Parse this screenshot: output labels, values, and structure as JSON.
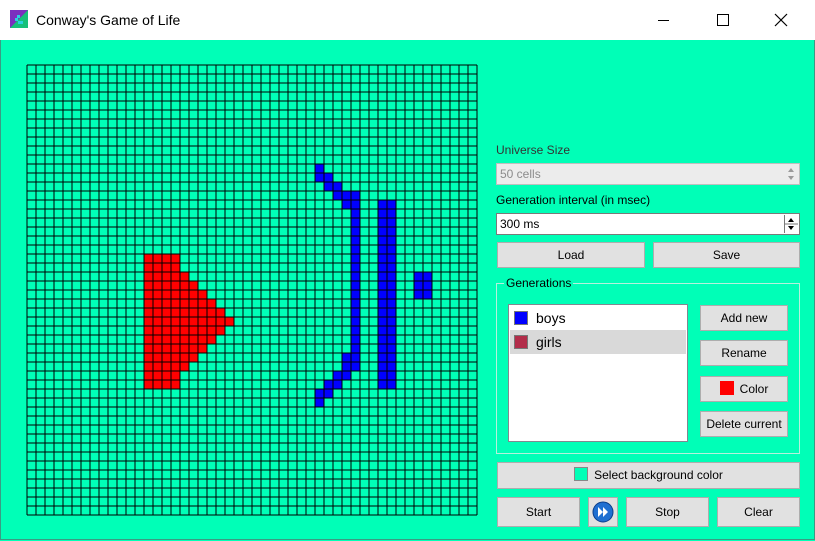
{
  "window": {
    "title": "Conway's Game of Life",
    "icon": "game-of-life-app-icon",
    "controls": [
      "minimize-icon",
      "maximize-icon",
      "close-icon"
    ]
  },
  "colors": {
    "background": "#00ffb7",
    "grid_line": "#000000",
    "boys": "#0000ff",
    "girls": "#ff0000",
    "girls_swatch": "#b22d4a"
  },
  "universe": {
    "size_label": "Universe Size",
    "size_value": "50 cells",
    "interval_label": "Generation interval (in msec)",
    "interval_value": "300 ms"
  },
  "buttons": {
    "load": "Load",
    "save": "Save",
    "add_new": "Add new",
    "rename": "Rename",
    "color": "Color",
    "delete_current": "Delete current",
    "select_background": "Select background color",
    "start": "Start",
    "stop": "Stop",
    "clear": "Clear",
    "step_icon": "fast-forward-icon"
  },
  "generations": {
    "title": "Generations",
    "items": [
      {
        "name": "boys",
        "color": "#0000ff",
        "selected": false
      },
      {
        "name": "girls",
        "color": "#b22d4a",
        "selected": true
      }
    ]
  },
  "board": {
    "cols": 50,
    "rows": 50,
    "red_cells": [
      "21:13-16",
      "22:13-16",
      "23:13-17",
      "24:13-18",
      "25:13-19",
      "26:13-20",
      "27:13-21",
      "28:13-22",
      "29:13-21",
      "30:13-20",
      "31:13-19",
      "32:13-18",
      "33:13-17",
      "34:13-16",
      "35:13-16"
    ],
    "blue_cells": [
      "11:32",
      "12:32-33",
      "13:33-34",
      "14:34-36",
      "15:35-36",
      "15:39-40",
      "16:36",
      "16:39-40",
      "17:36",
      "17:39-40",
      "18:36",
      "18:39-40",
      "19:36",
      "19:39-40",
      "20:36",
      "20:39-40",
      "21:36",
      "21:39-40",
      "22:36",
      "22:39-40",
      "23:36",
      "23:39-40",
      "23:43-44",
      "24:36",
      "24:39-40",
      "24:43-44",
      "25:36",
      "25:39-40",
      "25:43-44",
      "26:36",
      "26:39-40",
      "27:36",
      "27:39-40",
      "28:36",
      "28:39-40",
      "29:36",
      "29:39-40",
      "30:36",
      "30:39-40",
      "31:36",
      "31:39-40",
      "32:35-36",
      "32:39-40",
      "33:35-36",
      "33:39-40",
      "34:34-35",
      "34:39-40",
      "35:33-34",
      "35:39-40",
      "36:32-33",
      "37:32"
    ]
  }
}
